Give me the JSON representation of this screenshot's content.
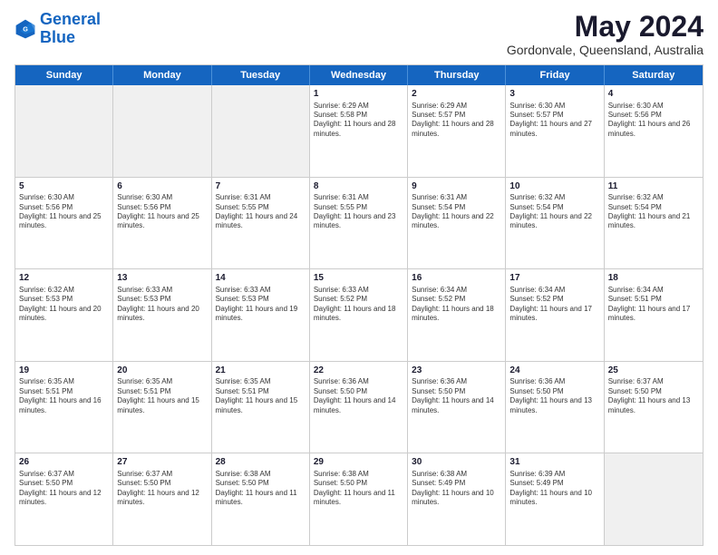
{
  "logo": {
    "line1": "General",
    "line2": "Blue"
  },
  "header": {
    "month": "May 2024",
    "location": "Gordonvale, Queensland, Australia"
  },
  "weekdays": [
    "Sunday",
    "Monday",
    "Tuesday",
    "Wednesday",
    "Thursday",
    "Friday",
    "Saturday"
  ],
  "weeks": [
    [
      {
        "day": "",
        "empty": true
      },
      {
        "day": "",
        "empty": true
      },
      {
        "day": "",
        "empty": true
      },
      {
        "day": "1",
        "sunrise": "Sunrise: 6:29 AM",
        "sunset": "Sunset: 5:58 PM",
        "daylight": "Daylight: 11 hours and 28 minutes."
      },
      {
        "day": "2",
        "sunrise": "Sunrise: 6:29 AM",
        "sunset": "Sunset: 5:57 PM",
        "daylight": "Daylight: 11 hours and 28 minutes."
      },
      {
        "day": "3",
        "sunrise": "Sunrise: 6:30 AM",
        "sunset": "Sunset: 5:57 PM",
        "daylight": "Daylight: 11 hours and 27 minutes."
      },
      {
        "day": "4",
        "sunrise": "Sunrise: 6:30 AM",
        "sunset": "Sunset: 5:56 PM",
        "daylight": "Daylight: 11 hours and 26 minutes."
      }
    ],
    [
      {
        "day": "5",
        "sunrise": "Sunrise: 6:30 AM",
        "sunset": "Sunset: 5:56 PM",
        "daylight": "Daylight: 11 hours and 25 minutes."
      },
      {
        "day": "6",
        "sunrise": "Sunrise: 6:30 AM",
        "sunset": "Sunset: 5:56 PM",
        "daylight": "Daylight: 11 hours and 25 minutes."
      },
      {
        "day": "7",
        "sunrise": "Sunrise: 6:31 AM",
        "sunset": "Sunset: 5:55 PM",
        "daylight": "Daylight: 11 hours and 24 minutes."
      },
      {
        "day": "8",
        "sunrise": "Sunrise: 6:31 AM",
        "sunset": "Sunset: 5:55 PM",
        "daylight": "Daylight: 11 hours and 23 minutes."
      },
      {
        "day": "9",
        "sunrise": "Sunrise: 6:31 AM",
        "sunset": "Sunset: 5:54 PM",
        "daylight": "Daylight: 11 hours and 22 minutes."
      },
      {
        "day": "10",
        "sunrise": "Sunrise: 6:32 AM",
        "sunset": "Sunset: 5:54 PM",
        "daylight": "Daylight: 11 hours and 22 minutes."
      },
      {
        "day": "11",
        "sunrise": "Sunrise: 6:32 AM",
        "sunset": "Sunset: 5:54 PM",
        "daylight": "Daylight: 11 hours and 21 minutes."
      }
    ],
    [
      {
        "day": "12",
        "sunrise": "Sunrise: 6:32 AM",
        "sunset": "Sunset: 5:53 PM",
        "daylight": "Daylight: 11 hours and 20 minutes."
      },
      {
        "day": "13",
        "sunrise": "Sunrise: 6:33 AM",
        "sunset": "Sunset: 5:53 PM",
        "daylight": "Daylight: 11 hours and 20 minutes."
      },
      {
        "day": "14",
        "sunrise": "Sunrise: 6:33 AM",
        "sunset": "Sunset: 5:53 PM",
        "daylight": "Daylight: 11 hours and 19 minutes."
      },
      {
        "day": "15",
        "sunrise": "Sunrise: 6:33 AM",
        "sunset": "Sunset: 5:52 PM",
        "daylight": "Daylight: 11 hours and 18 minutes."
      },
      {
        "day": "16",
        "sunrise": "Sunrise: 6:34 AM",
        "sunset": "Sunset: 5:52 PM",
        "daylight": "Daylight: 11 hours and 18 minutes."
      },
      {
        "day": "17",
        "sunrise": "Sunrise: 6:34 AM",
        "sunset": "Sunset: 5:52 PM",
        "daylight": "Daylight: 11 hours and 17 minutes."
      },
      {
        "day": "18",
        "sunrise": "Sunrise: 6:34 AM",
        "sunset": "Sunset: 5:51 PM",
        "daylight": "Daylight: 11 hours and 17 minutes."
      }
    ],
    [
      {
        "day": "19",
        "sunrise": "Sunrise: 6:35 AM",
        "sunset": "Sunset: 5:51 PM",
        "daylight": "Daylight: 11 hours and 16 minutes."
      },
      {
        "day": "20",
        "sunrise": "Sunrise: 6:35 AM",
        "sunset": "Sunset: 5:51 PM",
        "daylight": "Daylight: 11 hours and 15 minutes."
      },
      {
        "day": "21",
        "sunrise": "Sunrise: 6:35 AM",
        "sunset": "Sunset: 5:51 PM",
        "daylight": "Daylight: 11 hours and 15 minutes."
      },
      {
        "day": "22",
        "sunrise": "Sunrise: 6:36 AM",
        "sunset": "Sunset: 5:50 PM",
        "daylight": "Daylight: 11 hours and 14 minutes."
      },
      {
        "day": "23",
        "sunrise": "Sunrise: 6:36 AM",
        "sunset": "Sunset: 5:50 PM",
        "daylight": "Daylight: 11 hours and 14 minutes."
      },
      {
        "day": "24",
        "sunrise": "Sunrise: 6:36 AM",
        "sunset": "Sunset: 5:50 PM",
        "daylight": "Daylight: 11 hours and 13 minutes."
      },
      {
        "day": "25",
        "sunrise": "Sunrise: 6:37 AM",
        "sunset": "Sunset: 5:50 PM",
        "daylight": "Daylight: 11 hours and 13 minutes."
      }
    ],
    [
      {
        "day": "26",
        "sunrise": "Sunrise: 6:37 AM",
        "sunset": "Sunset: 5:50 PM",
        "daylight": "Daylight: 11 hours and 12 minutes."
      },
      {
        "day": "27",
        "sunrise": "Sunrise: 6:37 AM",
        "sunset": "Sunset: 5:50 PM",
        "daylight": "Daylight: 11 hours and 12 minutes."
      },
      {
        "day": "28",
        "sunrise": "Sunrise: 6:38 AM",
        "sunset": "Sunset: 5:50 PM",
        "daylight": "Daylight: 11 hours and 11 minutes."
      },
      {
        "day": "29",
        "sunrise": "Sunrise: 6:38 AM",
        "sunset": "Sunset: 5:50 PM",
        "daylight": "Daylight: 11 hours and 11 minutes."
      },
      {
        "day": "30",
        "sunrise": "Sunrise: 6:38 AM",
        "sunset": "Sunset: 5:49 PM",
        "daylight": "Daylight: 11 hours and 10 minutes."
      },
      {
        "day": "31",
        "sunrise": "Sunrise: 6:39 AM",
        "sunset": "Sunset: 5:49 PM",
        "daylight": "Daylight: 11 hours and 10 minutes."
      },
      {
        "day": "",
        "empty": true
      }
    ]
  ]
}
